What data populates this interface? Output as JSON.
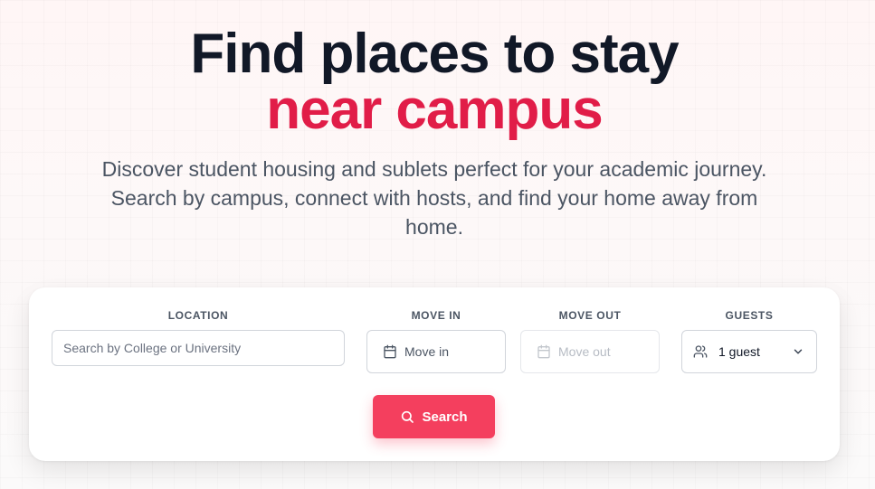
{
  "hero": {
    "title_line1": "Find places to stay",
    "title_line2": "near campus",
    "subtitle": "Discover student housing and sublets perfect for your academic journey. Search by campus, connect with hosts, and find your home away from home."
  },
  "search": {
    "location_label": "LOCATION",
    "location_placeholder": "Search by College or University",
    "move_in_label": "MOVE IN",
    "move_in_value": "Move in",
    "move_out_label": "MOVE OUT",
    "move_out_value": "Move out",
    "guests_label": "GUESTS",
    "guests_value": "1 guest",
    "button_label": "Search"
  },
  "colors": {
    "accent": "#e11d48",
    "button": "#f43f5e",
    "heading": "#111827"
  },
  "icons": [
    "calendar-icon",
    "users-icon",
    "chevron-down-icon",
    "search-icon"
  ]
}
